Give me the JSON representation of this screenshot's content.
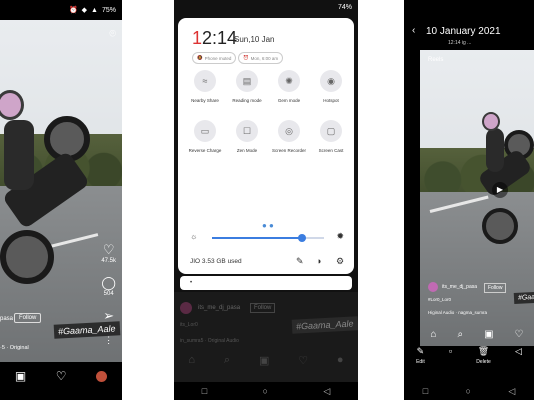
{
  "panel1": {
    "status": {
      "battery": "75%"
    },
    "likes": "47.5k",
    "comments": "504",
    "follow_button": "Follow",
    "username_fragment": "pasa",
    "caption_tag": "#Gaama_Aale",
    "audio": "·5 · Original"
  },
  "panel2": {
    "status": {
      "battery": "74%"
    },
    "time": "12:14",
    "time_first_char": "1",
    "time_rest": "2:14",
    "date": "Sun,10 Jan",
    "pills": [
      "Phone muted",
      "Mon, 6:00 am"
    ],
    "tiles": [
      {
        "label": "Nearby Share",
        "icon": "nearby-share-icon"
      },
      {
        "label": "Reading mode",
        "icon": "reading-mode-icon"
      },
      {
        "label": "Gem mode",
        "icon": "game-mode-icon"
      },
      {
        "label": "Hotspot",
        "icon": "hotspot-icon"
      },
      {
        "label": "Reverse Charge",
        "icon": "reverse-charge-icon"
      },
      {
        "label": "Zen Mode",
        "icon": "zen-mode-icon"
      },
      {
        "label": "Screen Recorder",
        "icon": "screen-recorder-icon"
      },
      {
        "label": "Screen Cast",
        "icon": "screen-cast-icon"
      }
    ],
    "storage": "JIO 3.53 GB used",
    "search_text": "•",
    "behind_username": "its_me_dj_pasa",
    "behind_follow": "Follow",
    "behind_caption_tag": "#Gaama_Aale",
    "behind_line1": "in_sumra5 · Original Audio",
    "behind_line_small": "its_Lor0"
  },
  "panel3": {
    "title": "10 January 2021",
    "subtitle": "12:14  ig  ...",
    "reels_label": "Reels",
    "username": "its_me_dj_pasa",
    "follow_button": "Follow",
    "handle": "#Lor0_Lor0",
    "audio": "Higinal Audio · nagma_sumra",
    "caption_tag": "#Gaama_",
    "actions": [
      {
        "label": "Edit",
        "icon": "edit-icon"
      },
      {
        "label": "",
        "icon": "square-icon"
      },
      {
        "label": "Delete",
        "icon": "delete-icon"
      },
      {
        "label": "",
        "icon": "more-icon"
      }
    ]
  }
}
